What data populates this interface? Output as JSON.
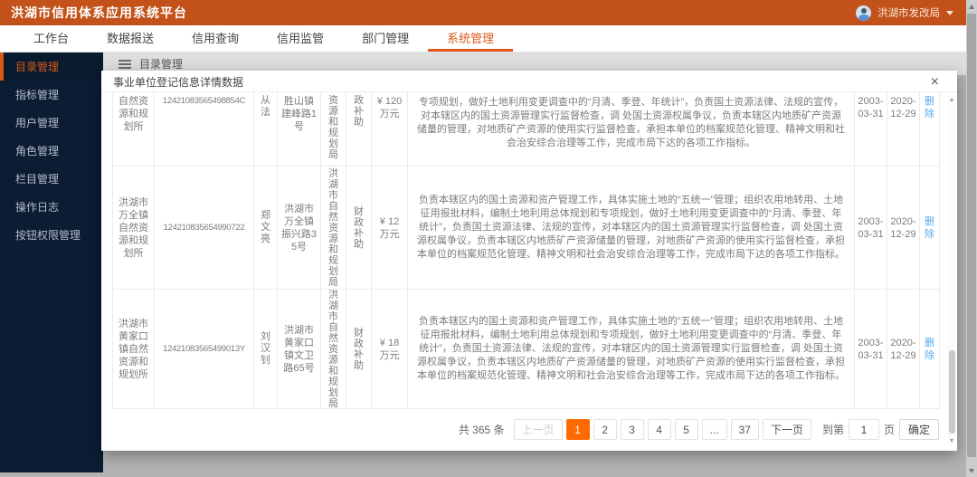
{
  "header": {
    "title": "洪湖市信用体系应用系统平台",
    "user": {
      "name": "洪湖市发改局"
    }
  },
  "nav": {
    "tabs": [
      {
        "label": "工作台"
      },
      {
        "label": "数据报送"
      },
      {
        "label": "信用查询"
      },
      {
        "label": "信用监管"
      },
      {
        "label": "部门管理"
      },
      {
        "label": "系统管理"
      }
    ],
    "active": "系统管理"
  },
  "sidebar": {
    "items": [
      {
        "label": "目录管理"
      },
      {
        "label": "指标管理"
      },
      {
        "label": "用户管理"
      },
      {
        "label": "角色管理"
      },
      {
        "label": "栏目管理"
      },
      {
        "label": "操作日志"
      },
      {
        "label": "按钮权限管理"
      }
    ],
    "active": "目录管理"
  },
  "breadcrumb": {
    "label": "目录管理"
  },
  "modal": {
    "title": "事业单位登记信息详情数据",
    "close": "×",
    "table": {
      "rows": [
        {
          "org": "自然资源和规划所",
          "credit_code": "12421083565498854C",
          "person": "从法",
          "address": "胜山镇建峰路1号",
          "dept": "资源和规划局",
          "funding": "政补助",
          "amount": "¥ 120 万元",
          "duty": "专项规划，做好土地利用变更调查中的“月清、季登、年统计”，负责国土资源法律、法规的宣传，对本辖区内的国土资源管理实行监督检查，调 处国土资源权属争议，负责本辖区内地质矿产资源储量的管理，对地质矿产资源的使用实行监督检查，承担本单位的档案规范化管理、精神文明和社会治安综合治理等工作，完成市局下达的各项工作指标。",
          "start_date": "2003-03-31",
          "end_date": "2020-12-29",
          "action": "删除"
        },
        {
          "org": "洪湖市万全镇自然资源和规划所",
          "credit_code": "124210835654990722",
          "person": "郑文亮",
          "address": "洪湖市万全镇振兴路35号",
          "dept": "洪湖市自然资源和规划局",
          "funding": "财政补助",
          "amount": "¥ 12 万元",
          "duty": "负责本辖区内的国土资源和资产管理工作，具体实施土地的“五统一”管理；组织农用地转用、土地征用报批材料，编制土地利用总体规划和专项规划，做好土地利用变更调查中的“月清、季登、年统计”，负责国土资源法律、法规的宣传，对本辖区内的国土资源管理实行监督检查，调 处国土资源权属争议，负责本辖区内地质矿产资源储量的管理，对地质矿产资源的使用实行监督检查，承担本单位的档案规范化管理、精神文明和社会治安综合治理等工作，完成市局下达的各项工作指标。",
          "start_date": "2003-03-31",
          "end_date": "2020-12-29",
          "action": "删除"
        },
        {
          "org": "洪湖市黄家口镇自然资源和规划所",
          "credit_code": "12421083565499013Y",
          "person": "刘汉钊",
          "address": "洪湖市黄家口镇文卫路65号",
          "dept": "洪湖市自然资源和规划局",
          "funding": "财政补助",
          "amount": "¥ 18 万元",
          "duty": "负责本辖区内的国土资源和资产管理工作，具体实施土地的“五统一”管理；组织农用地转用、土地征用报批材料，编制土地利用总体规划和专项规划，做好土地利用变更调查中的“月清、季登、年统计”，负责国土资源法律、法规的宣传，对本辖区内的国土资源管理实行监督检查，调 处国土资源权属争议，负责本辖区内地质矿产资源储量的管理，对地质矿产资源的使用实行监督检查，承担本单位的档案规范化管理、精神文明和社会治安综合治理等工作，完成市局下达的各项工作指标。",
          "start_date": "2003-03-31",
          "end_date": "2020-12-29",
          "action": "删除"
        }
      ]
    },
    "pagination": {
      "total": "共 365 条",
      "prev": "上一页",
      "pages": [
        "1",
        "2",
        "3",
        "4",
        "5",
        "...",
        "37"
      ],
      "active_page": "1",
      "next": "下一页",
      "goto_prefix": "到第",
      "goto_value": "1",
      "goto_suffix": "页",
      "confirm": "确定"
    }
  },
  "colors": {
    "header_bg": "#c2511a",
    "accent": "#dd5a1b",
    "active_page_bg": "#ff6a00",
    "sidebar_bg": "#0b1c33",
    "link_blue": "#55aaf0"
  }
}
